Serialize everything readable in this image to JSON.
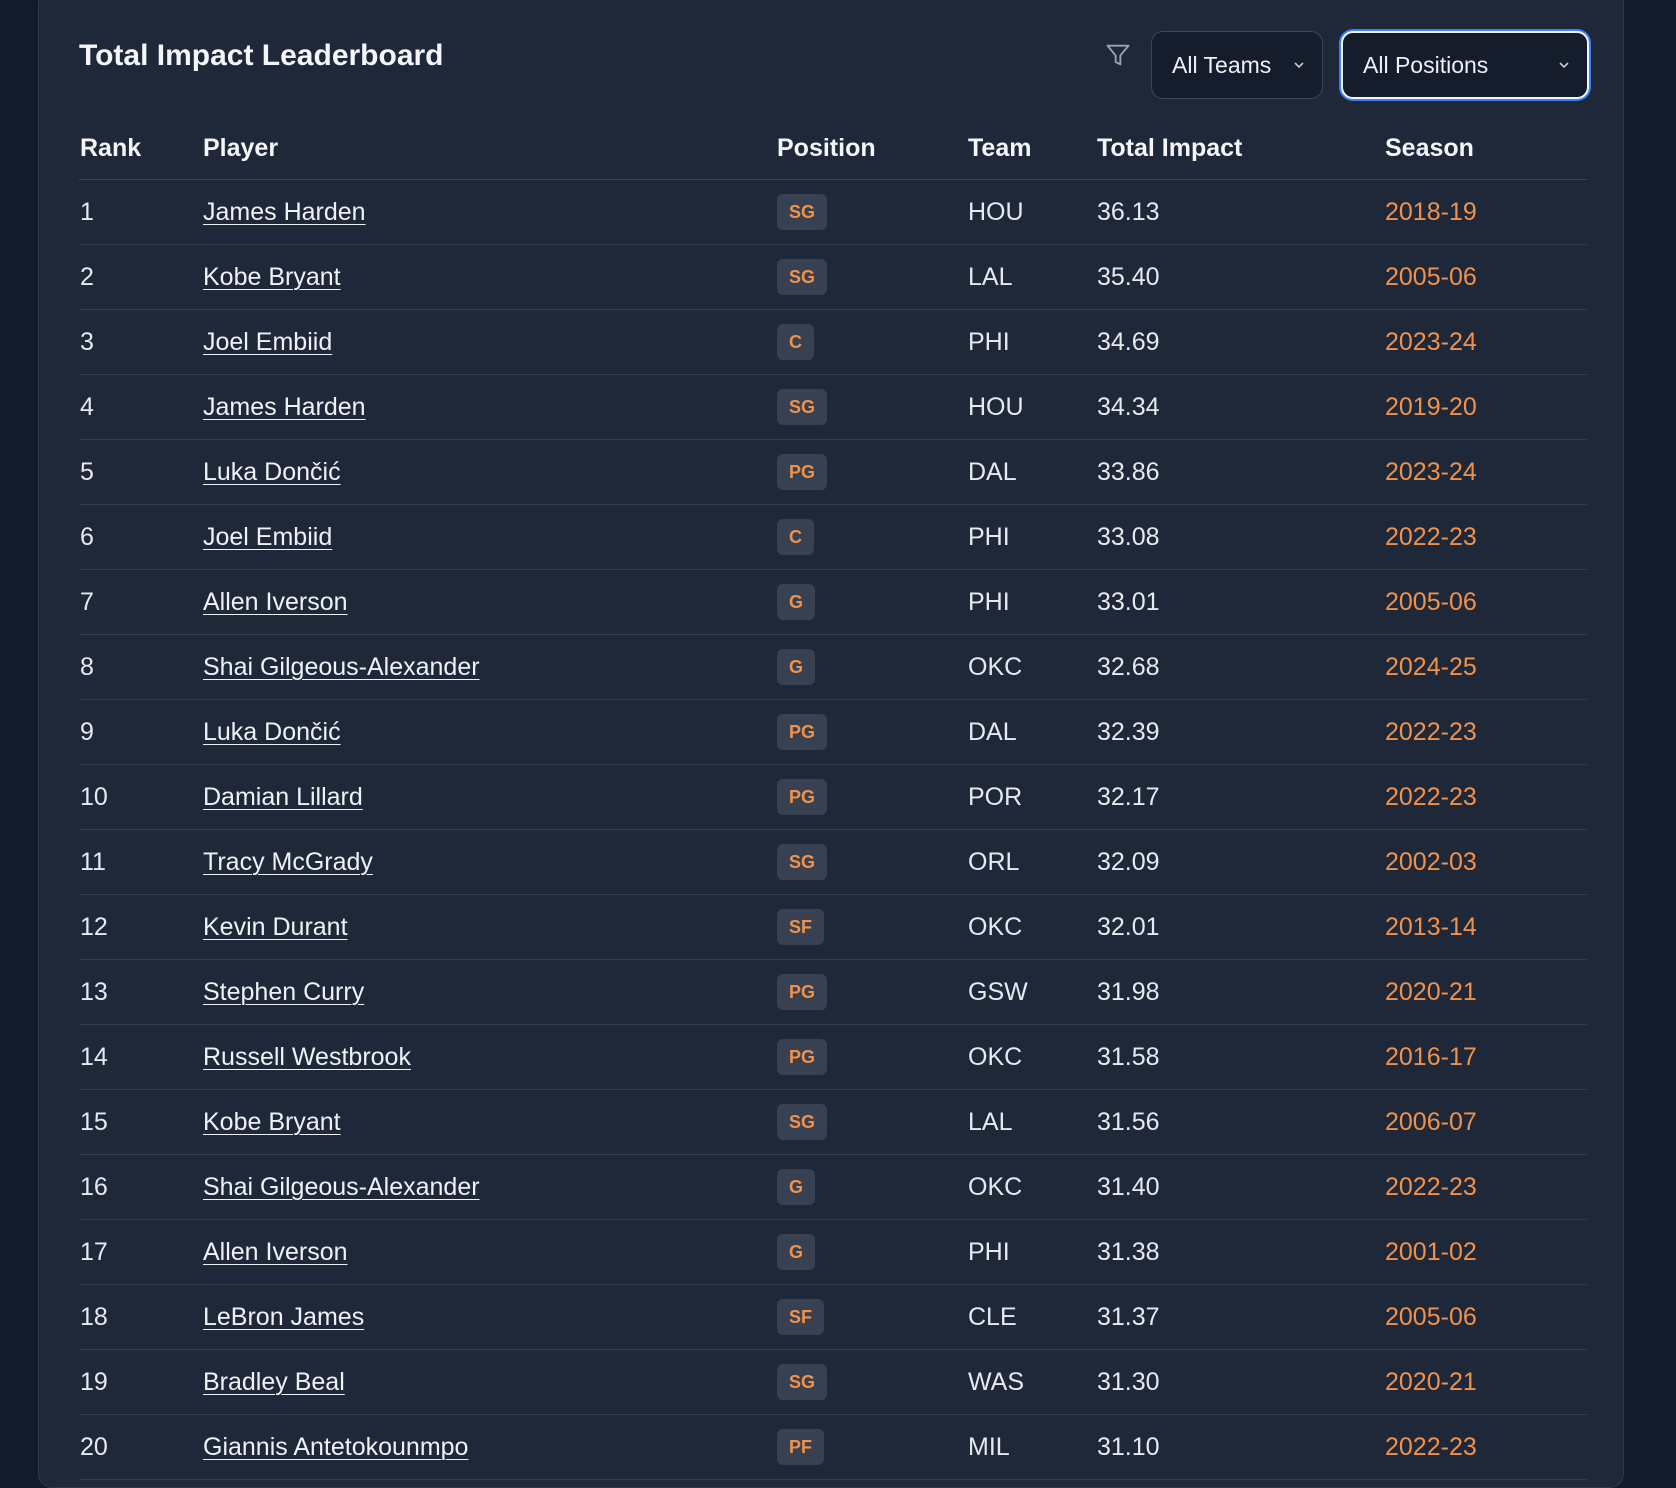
{
  "header": {
    "title": "Total Impact Leaderboard",
    "team_select": "All Teams",
    "position_select": "All Positions"
  },
  "icons": {
    "filter": "filter-icon",
    "chevron": "chevron-down-icon"
  },
  "colors": {
    "accent": "#f0924b",
    "card_bg": "#1f2839",
    "page_bg": "#131a2b",
    "focus_ring": "#3b82f6"
  },
  "table": {
    "columns": [
      "Rank",
      "Player",
      "Position",
      "Team",
      "Total Impact",
      "Season"
    ],
    "rows": [
      {
        "rank": "1",
        "player": "James Harden",
        "position": "SG",
        "team": "HOU",
        "impact": "36.13",
        "season": "2018-19"
      },
      {
        "rank": "2",
        "player": "Kobe Bryant",
        "position": "SG",
        "team": "LAL",
        "impact": "35.40",
        "season": "2005-06"
      },
      {
        "rank": "3",
        "player": "Joel Embiid",
        "position": "C",
        "team": "PHI",
        "impact": "34.69",
        "season": "2023-24"
      },
      {
        "rank": "4",
        "player": "James Harden",
        "position": "SG",
        "team": "HOU",
        "impact": "34.34",
        "season": "2019-20"
      },
      {
        "rank": "5",
        "player": "Luka Dončić",
        "position": "PG",
        "team": "DAL",
        "impact": "33.86",
        "season": "2023-24"
      },
      {
        "rank": "6",
        "player": "Joel Embiid",
        "position": "C",
        "team": "PHI",
        "impact": "33.08",
        "season": "2022-23"
      },
      {
        "rank": "7",
        "player": "Allen Iverson",
        "position": "G",
        "team": "PHI",
        "impact": "33.01",
        "season": "2005-06"
      },
      {
        "rank": "8",
        "player": "Shai Gilgeous-Alexander",
        "position": "G",
        "team": "OKC",
        "impact": "32.68",
        "season": "2024-25"
      },
      {
        "rank": "9",
        "player": "Luka Dončić",
        "position": "PG",
        "team": "DAL",
        "impact": "32.39",
        "season": "2022-23"
      },
      {
        "rank": "10",
        "player": "Damian Lillard",
        "position": "PG",
        "team": "POR",
        "impact": "32.17",
        "season": "2022-23"
      },
      {
        "rank": "11",
        "player": "Tracy McGrady",
        "position": "SG",
        "team": "ORL",
        "impact": "32.09",
        "season": "2002-03"
      },
      {
        "rank": "12",
        "player": "Kevin Durant",
        "position": "SF",
        "team": "OKC",
        "impact": "32.01",
        "season": "2013-14"
      },
      {
        "rank": "13",
        "player": "Stephen Curry",
        "position": "PG",
        "team": "GSW",
        "impact": "31.98",
        "season": "2020-21"
      },
      {
        "rank": "14",
        "player": "Russell Westbrook",
        "position": "PG",
        "team": "OKC",
        "impact": "31.58",
        "season": "2016-17"
      },
      {
        "rank": "15",
        "player": "Kobe Bryant",
        "position": "SG",
        "team": "LAL",
        "impact": "31.56",
        "season": "2006-07"
      },
      {
        "rank": "16",
        "player": "Shai Gilgeous-Alexander",
        "position": "G",
        "team": "OKC",
        "impact": "31.40",
        "season": "2022-23"
      },
      {
        "rank": "17",
        "player": "Allen Iverson",
        "position": "G",
        "team": "PHI",
        "impact": "31.38",
        "season": "2001-02"
      },
      {
        "rank": "18",
        "player": "LeBron James",
        "position": "SF",
        "team": "CLE",
        "impact": "31.37",
        "season": "2005-06"
      },
      {
        "rank": "19",
        "player": "Bradley Beal",
        "position": "SG",
        "team": "WAS",
        "impact": "31.30",
        "season": "2020-21"
      },
      {
        "rank": "20",
        "player": "Giannis Antetokounmpo",
        "position": "PF",
        "team": "MIL",
        "impact": "31.10",
        "season": "2022-23"
      }
    ]
  }
}
